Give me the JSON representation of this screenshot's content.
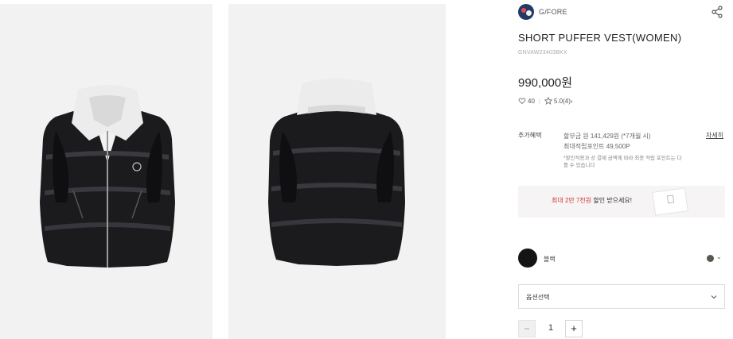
{
  "brand": {
    "name": "G/FORE",
    "logo_icon": "brand-logo-icon",
    "share_icon": "share-icon"
  },
  "product": {
    "title": "SHORT PUFFER VEST(WOMEN)",
    "code": "GNVAW23403BKX",
    "price": "990,000원"
  },
  "meta": {
    "likes": "40",
    "rating": "5.0",
    "reviews": "(4)",
    "reviews_arrow": "›"
  },
  "benefits": {
    "label": "추가혜택",
    "installment": "할부금 원 141,429원 (*7개월 시)",
    "points": "최대적립포인트 49,500P",
    "note": "*할인적용과 상 결제 금액에 따라 최종 적립 포인트는 다를 수 있습니다",
    "detail_link": "자세히"
  },
  "banner": {
    "prefix": "최대 2만 7천원",
    "suffix": " 할인 받으세요!"
  },
  "color": {
    "name": "블랙",
    "swatch": "#141414",
    "alt_swatch": "#555a4e",
    "chevron": "⌄"
  },
  "option": {
    "label": "옵션선택"
  },
  "quantity": {
    "minus": "−",
    "value": "1",
    "plus": "+"
  },
  "images": {
    "front_alt": "front view product photo",
    "back_alt": "back view product photo"
  }
}
